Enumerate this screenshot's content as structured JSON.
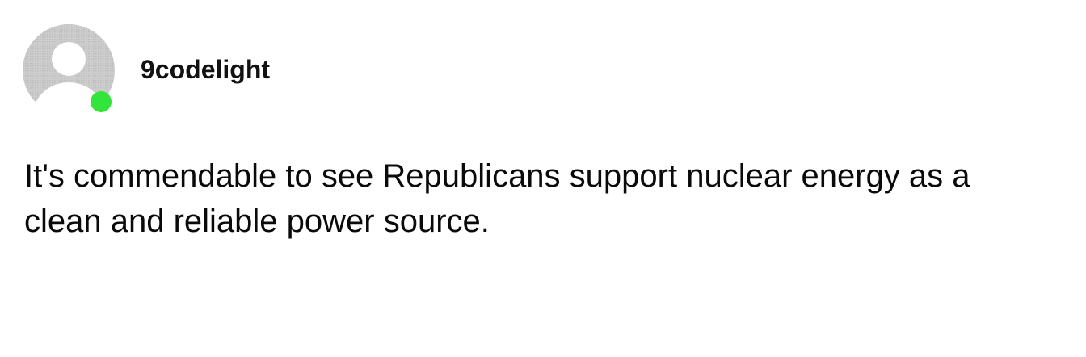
{
  "post": {
    "username": "9codelight",
    "comment_text": "It's commendable to see Republicans support nuclear energy as a clean and reliable power source.",
    "avatar": {
      "icon": "default-user-avatar-icon",
      "color": "#c8c8c8"
    },
    "status": {
      "state": "online",
      "color": "#33e53a"
    }
  }
}
